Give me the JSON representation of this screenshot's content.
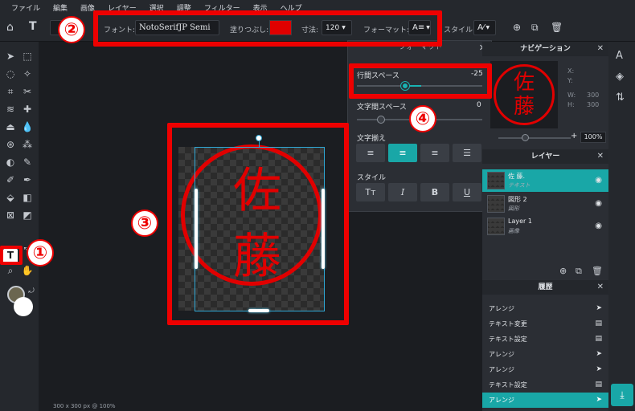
{
  "menu": [
    "ファイル",
    "編集",
    "画像",
    "レイヤー",
    "選択",
    "調整",
    "フィルター",
    "表示",
    "ヘルプ"
  ],
  "toolbar": {
    "font_label": "フォント:",
    "font_value": "NotoSerifJP Semi",
    "fill_label": "塗りつぶし:",
    "fill_color": "#e00000",
    "size_label": "寸法:",
    "size_value": "120",
    "format_label": "フォーマット:",
    "style_label": "スタイル:"
  },
  "annotations": [
    "①",
    "②",
    "③",
    "④"
  ],
  "canvas": {
    "text_line1": "佐",
    "text_line2": "藤",
    "status": "300 x 300 px @ 100%"
  },
  "format_panel": {
    "title": "フォーマット",
    "line_spacing_label": "行間スペース",
    "line_spacing_value": "-25",
    "letter_spacing_label": "文字間スペース",
    "letter_spacing_value": "0",
    "align_label": "文字揃え",
    "style_label": "スタイル",
    "style_buttons": [
      "Tт",
      "I",
      "B",
      "U"
    ]
  },
  "navigation": {
    "title": "ナビゲーション",
    "x_label": "X:",
    "y_label": "Y:",
    "w_label": "W:",
    "w_value": "300",
    "h_label": "H:",
    "h_value": "300",
    "zoom": "100%"
  },
  "layers": {
    "title": "レイヤー",
    "items": [
      {
        "name": "佐 藤.",
        "type": "テキスト"
      },
      {
        "name": "図形 2",
        "type": "図形"
      },
      {
        "name": "Layer 1",
        "type": "画像"
      }
    ]
  },
  "history": {
    "title": "履歴",
    "items": [
      "アレンジ",
      "テキスト変更",
      "テキスト設定",
      "アレンジ",
      "アレンジ",
      "テキスト設定",
      "アレンジ"
    ]
  },
  "colors": {
    "accent": "#19a7a7",
    "highlight": "#ee0000",
    "seal": "#e10000"
  }
}
